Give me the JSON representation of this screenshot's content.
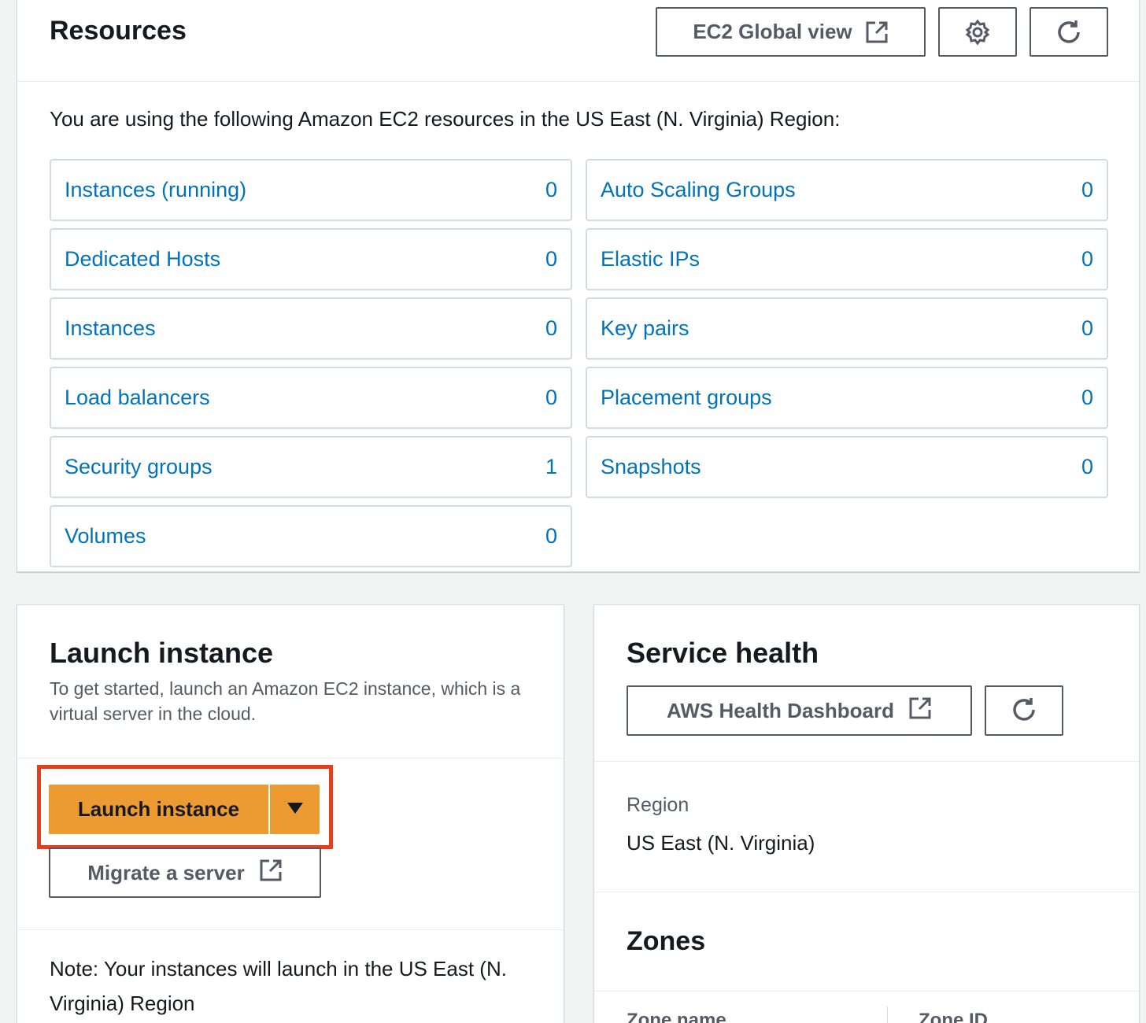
{
  "resources": {
    "title": "Resources",
    "global_view_label": "EC2 Global view",
    "intro": "You are using the following Amazon EC2 resources in the US East (N. Virginia) Region:",
    "left_items": [
      {
        "label": "Instances (running)",
        "count": "0"
      },
      {
        "label": "Dedicated Hosts",
        "count": "0"
      },
      {
        "label": "Instances",
        "count": "0"
      },
      {
        "label": "Load balancers",
        "count": "0"
      },
      {
        "label": "Security groups",
        "count": "1"
      },
      {
        "label": "Volumes",
        "count": "0"
      }
    ],
    "right_items": [
      {
        "label": "Auto Scaling Groups",
        "count": "0"
      },
      {
        "label": "Elastic IPs",
        "count": "0"
      },
      {
        "label": "Key pairs",
        "count": "0"
      },
      {
        "label": "Placement groups",
        "count": "0"
      },
      {
        "label": "Snapshots",
        "count": "0"
      }
    ]
  },
  "launch": {
    "title": "Launch instance",
    "description": "To get started, launch an Amazon EC2 instance, which is a virtual server in the cloud.",
    "launch_button": "Launch instance",
    "migrate_button": "Migrate a server",
    "note": "Note: Your instances will launch in the US East (N. Virginia) Region"
  },
  "service_health": {
    "title": "Service health",
    "dashboard_button": "AWS Health Dashboard",
    "region_label": "Region",
    "region_value": "US East (N. Virginia)",
    "zones_title": "Zones",
    "zone_col_name": "Zone name",
    "zone_col_id": "Zone ID"
  },
  "colors": {
    "link": "#0073bb",
    "primary_button": "#ec9a32",
    "highlight_box": "#e2401c"
  }
}
